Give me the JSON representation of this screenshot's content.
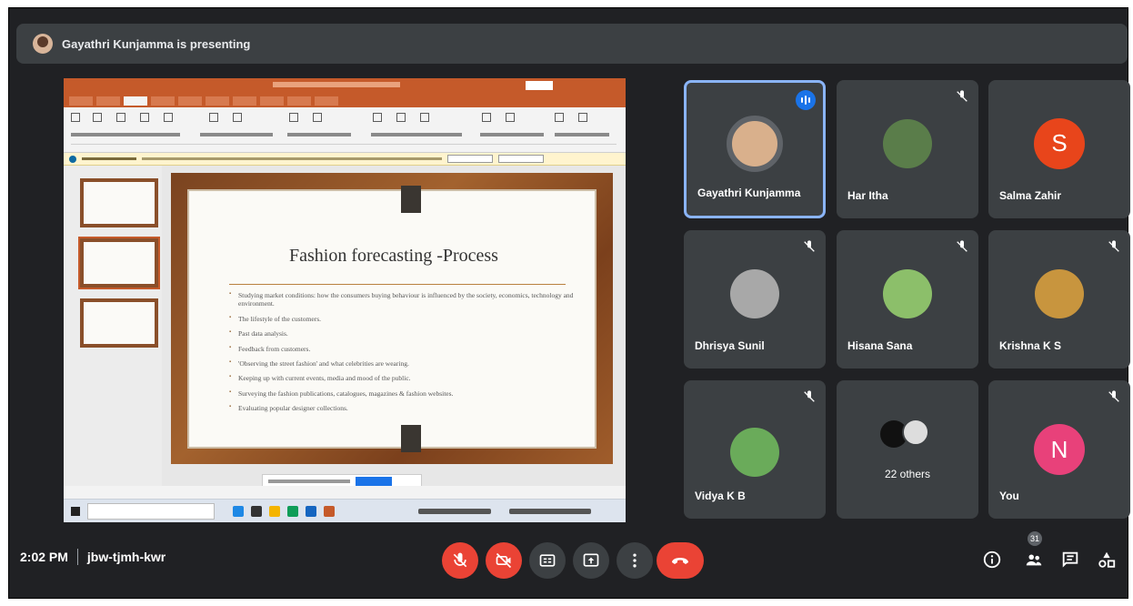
{
  "banner": {
    "presenting_text": "Gayathri Kunjamma is presenting"
  },
  "slide": {
    "title": "Fashion forecasting -Process",
    "bullets": [
      "Studying market conditions: how the consumers buying behaviour is influenced by the society, economics, technology and environment.",
      "The lifestyle of the customers.",
      "Past data analysis.",
      "Feedback from customers.",
      "'Observing the street fashion' and what celebrities are wearing.",
      "Keeping up with current events, media and mood of the public.",
      "Surveying the fashion publications, catalogues, magazines & fashion websites.",
      "Evaluating popular designer collections."
    ]
  },
  "participants": [
    {
      "name": "Gayathri Kunjamma",
      "speaking": true,
      "photo_color": "#d9b08c"
    },
    {
      "name": "Har Itha",
      "muted": true,
      "photo_color": "#5a7d4a"
    },
    {
      "name": "Salma Zahir",
      "muted": false,
      "letter": "S",
      "letter_bg": "#e8451b"
    },
    {
      "name": "Dhrisya Sunil",
      "muted": true,
      "photo_color": "#a8a8a8"
    },
    {
      "name": "Hisana Sana",
      "muted": true,
      "photo_color": "#8cbf6a"
    },
    {
      "name": "Krishna K S",
      "muted": true,
      "photo_color": "#c8953e"
    },
    {
      "name": "Vidya K B",
      "muted": true,
      "photo_color": "#6aab5a"
    },
    {
      "others_label": "22 others"
    },
    {
      "name": "You",
      "muted": true,
      "letter": "N",
      "letter_bg": "#e8417a"
    }
  ],
  "footer": {
    "time": "2:02 PM",
    "meeting_code": "jbw-tjmh-kwr",
    "people_count": "31"
  },
  "colors": {
    "background": "#202124",
    "tile": "#3c4043",
    "danger": "#ea4335",
    "accent": "#8ab4f8"
  }
}
